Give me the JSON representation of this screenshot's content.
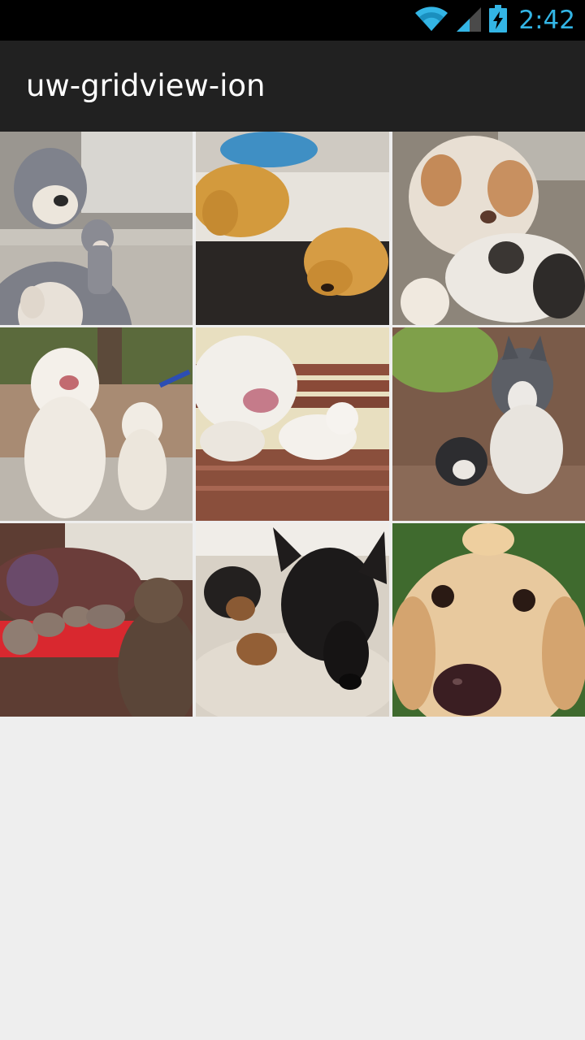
{
  "status_bar": {
    "time": "2:42",
    "icons": [
      "wifi-icon",
      "cell-signal-icon",
      "battery-charging-icon"
    ],
    "accent_color": "#33b5e5"
  },
  "action_bar": {
    "title": "uw-gridview-ion",
    "background": "#212121"
  },
  "grid": {
    "columns": 3,
    "background": "#eeeeee",
    "items": [
      {
        "icon": "pitbull-with-puppy-photo"
      },
      {
        "icon": "yellow-labradors-photo"
      },
      {
        "icon": "australian-shepherd-with-puppy-photo"
      },
      {
        "icon": "white-labradors-photo"
      },
      {
        "icon": "bulldogs-on-bench-photo"
      },
      {
        "icon": "husky-with-puppy-photo"
      },
      {
        "icon": "shar-pei-with-puppies-photo"
      },
      {
        "icon": "german-shepherds-photo"
      },
      {
        "icon": "golden-retriever-closeup-photo"
      }
    ]
  }
}
